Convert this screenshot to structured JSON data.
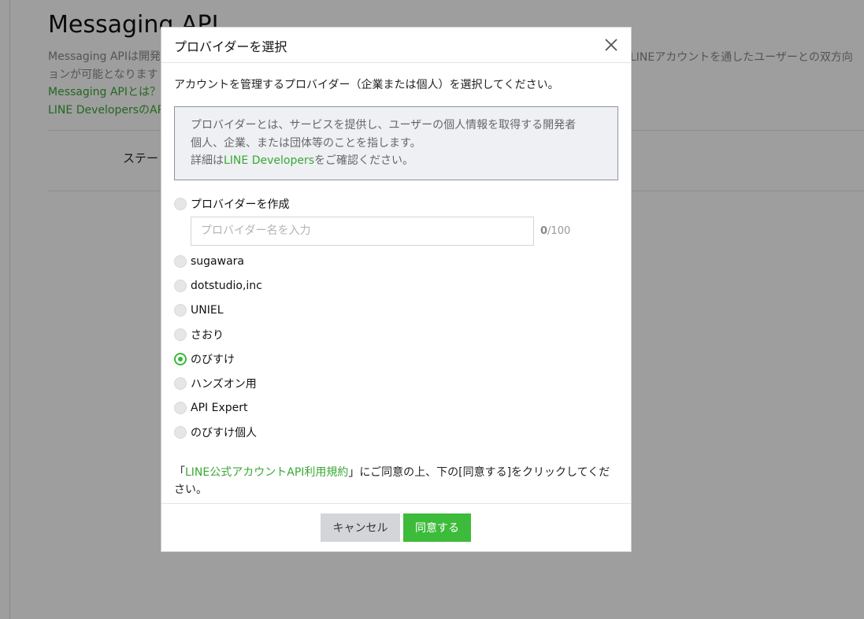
{
  "background": {
    "title": "Messaging API",
    "desc_line1": "Messaging APIは開発",
    "desc_line2": "ョンが可能となります",
    "desc_right": "LINEアカウントを通したユーザーとの双方向",
    "link1": "Messaging APIとは？",
    "link2": "LINE DevelopersのAP",
    "status_label": "ステー"
  },
  "modal": {
    "title": "プロバイダーを選択",
    "intro": "アカウントを管理するプロバイダー（企業または個人）を選択してください。",
    "info": {
      "line1": "プロバイダーとは、サービスを提供し、ユーザーの個人情報を取得する開発者",
      "line2": "個人、企業、または団体等のことを指します。",
      "line3_prefix": "詳細は",
      "line3_link": "LINE Developers",
      "line3_suffix": "をご確認ください。"
    },
    "create_option": "プロバイダーを作成",
    "name_placeholder": "プロバイダー名を入力",
    "counter_current": "0",
    "counter_max": "/100",
    "providers": [
      {
        "label": "sugawara",
        "selected": false
      },
      {
        "label": "dotstudio,inc",
        "selected": false
      },
      {
        "label": "UNIEL",
        "selected": false
      },
      {
        "label": "さおり",
        "selected": false
      },
      {
        "label": "のびすけ",
        "selected": true
      },
      {
        "label": "ハンズオン用",
        "selected": false
      },
      {
        "label": "API Expert",
        "selected": false
      },
      {
        "label": "のびすけ個人",
        "selected": false
      }
    ],
    "agreement": {
      "open": "「",
      "link": "LINE公式アカウントAPI利用規約",
      "rest": "」にご同意の上、下の[同意する]をクリックしてください。"
    },
    "cancel_label": "キャンセル",
    "agree_label": "同意する"
  },
  "colors": {
    "accent": "#38b83a",
    "link": "#38a833",
    "overlay": "rgba(0,0,0,0.38)"
  },
  "icons": {
    "close": "close-icon"
  }
}
